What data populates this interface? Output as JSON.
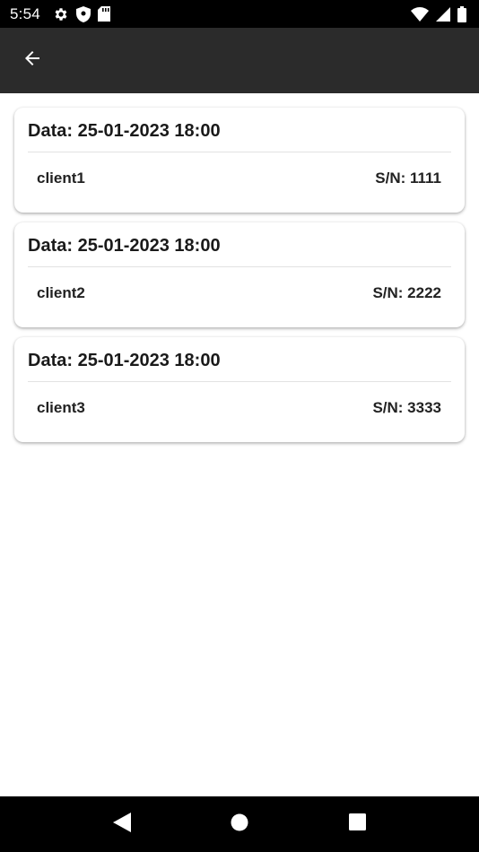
{
  "status_bar": {
    "time": "5:54",
    "left_icons": [
      "gear-icon",
      "shield-icon",
      "sd-card-icon"
    ],
    "right_icons": [
      "wifi-icon",
      "cell-signal-icon",
      "battery-icon"
    ]
  },
  "app_bar": {
    "back_icon": "arrow-back-icon",
    "background": "#2b2b2b"
  },
  "records": [
    {
      "date_label": "Data: 25-01-2023 18:00",
      "client": "client1",
      "serial": "S/N: 1111"
    },
    {
      "date_label": "Data: 25-01-2023 18:00",
      "client": "client2",
      "serial": "S/N: 2222"
    },
    {
      "date_label": "Data: 25-01-2023 18:00",
      "client": "client3",
      "serial": "S/N: 3333"
    }
  ],
  "nav_bar": {
    "buttons": [
      "back-triangle-icon",
      "home-circle-icon",
      "recents-square-icon"
    ]
  }
}
